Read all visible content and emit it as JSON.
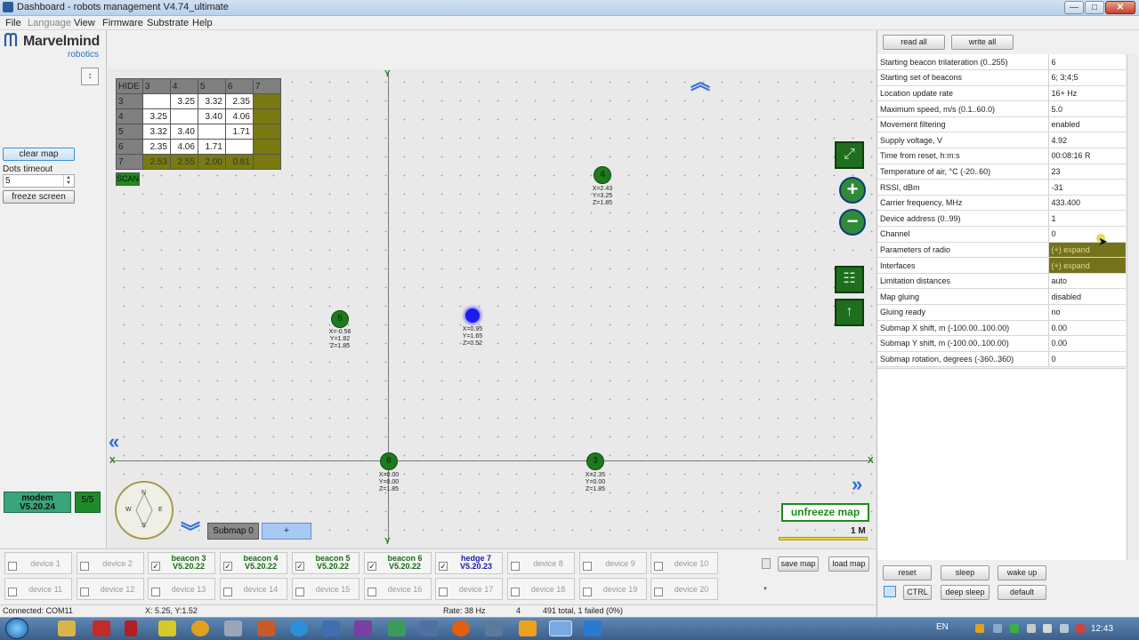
{
  "window": {
    "title": "Dashboard - robots management   V4.74_ultimate",
    "min_glyph": "—",
    "max_glyph": "□",
    "close_glyph": "✕"
  },
  "menu": [
    "File",
    "Language",
    "View",
    "Firmware",
    "Substrate",
    "Help"
  ],
  "left_panel": {
    "logo_text": "Marvelmind",
    "logo_sub": "robotics",
    "clear_map": "clear map",
    "dots_timeout_label": "Dots timeout",
    "dots_timeout_value": "5",
    "freeze_screen": "freeze screen",
    "modem_label": "modem",
    "modem_version": "V5.20.24",
    "modem_count": "5/5",
    "collapse_glyph": "↕"
  },
  "distance_table": {
    "hide_label": "HIDE",
    "scan_label": "SCAN",
    "header": [
      "3",
      "4",
      "5",
      "6",
      "7"
    ],
    "rows": [
      {
        "id": "3",
        "cells": [
          "",
          "3.25",
          "3.32",
          "2.35",
          ""
        ]
      },
      {
        "id": "4",
        "cells": [
          "3.25",
          "",
          "3.40",
          "4.06",
          ""
        ]
      },
      {
        "id": "5",
        "cells": [
          "3.32",
          "3.40",
          "",
          "1.71",
          ""
        ]
      },
      {
        "id": "6",
        "cells": [
          "2.35",
          "4.06",
          "1.71",
          "",
          ""
        ]
      },
      {
        "id": "7",
        "cells": [
          "2.53",
          "2.55",
          "2.00",
          "0.81",
          ""
        ]
      }
    ]
  },
  "map": {
    "beacons": [
      {
        "id": "4",
        "coords": "X=2.43\nY=3.25\nZ=1.85"
      },
      {
        "id": "5",
        "coords": "X=-0.56\nY=1.82\nZ=1.85"
      },
      {
        "id": "6",
        "coords": "X=0.00\nY=0.00\nZ=1.85"
      },
      {
        "id": "3",
        "coords": "X=2.35\nY=0.00\nZ=1.85"
      }
    ],
    "hedge": {
      "id": "7",
      "coords": "X=0.95\nY=1.65\nZ=0.52"
    },
    "axis_x_label": "X",
    "axis_y_label": "Y",
    "compass": {
      "n": "N",
      "s": "S",
      "e": "E",
      "w": "W"
    },
    "submap_label": "Submap 0",
    "submap_add": "+",
    "unfreeze": "unfreeze map",
    "scale": "1 M",
    "zoom_in": "+",
    "zoom_out": "−",
    "up_glyph": "︽",
    "down_glyph": "︾",
    "left_glyph": "«",
    "right_glyph": "»"
  },
  "devices_row1": [
    {
      "label": "device 1",
      "checked": false,
      "active": false
    },
    {
      "label": "device 2",
      "checked": false,
      "active": false
    },
    {
      "label": "beacon 3",
      "version": "V5.20.22",
      "checked": true,
      "active": true,
      "kind": "green"
    },
    {
      "label": "beacon 4",
      "version": "V5.20.22",
      "checked": true,
      "active": true,
      "kind": "green"
    },
    {
      "label": "beacon 5",
      "version": "V5.20.22",
      "checked": true,
      "active": true,
      "kind": "green"
    },
    {
      "label": "beacon 6",
      "version": "V5.20.22",
      "checked": true,
      "active": true,
      "kind": "green"
    },
    {
      "label": "hedge 7",
      "version": "V5.20.23",
      "checked": true,
      "active": true,
      "kind": "blue"
    },
    {
      "label": "device 8",
      "checked": false,
      "active": false
    },
    {
      "label": "device 9",
      "checked": false,
      "active": false
    },
    {
      "label": "device 10",
      "checked": false,
      "active": false
    }
  ],
  "devices_row2": [
    {
      "label": "device 11"
    },
    {
      "label": "device 12"
    },
    {
      "label": "device 13"
    },
    {
      "label": "device 14"
    },
    {
      "label": "device 15"
    },
    {
      "label": "device 16"
    },
    {
      "label": "device 17"
    },
    {
      "label": "device 18"
    },
    {
      "label": "device 19"
    },
    {
      "label": "device 20"
    }
  ],
  "device_buttons": {
    "save_map": "save map",
    "load_map": "load map"
  },
  "status": {
    "connected": "Connected: COM11",
    "cursor_xy": "X: 5.25, Y:1.52",
    "rate": "Rate: 38 Hz",
    "count": "4",
    "totals": "491 total, 1 failed (0%)"
  },
  "right_panel": {
    "read_all": "read all",
    "write_all": "write all",
    "params": [
      {
        "k": "Starting beacon trilateration (0..255)",
        "v": "6"
      },
      {
        "k": "Starting set of beacons",
        "v": "6;  3;4;5"
      },
      {
        "k": "Location update rate",
        "v": "16+ Hz"
      },
      {
        "k": "Maximum speed, m/s (0.1..60.0)",
        "v": "5.0"
      },
      {
        "k": "Movement filtering",
        "v": "enabled"
      },
      {
        "k": "Supply voltage, V",
        "v": "4.92"
      },
      {
        "k": "Time from reset, h:m:s",
        "v": "00:08:16   R"
      },
      {
        "k": "Temperature of air, °C (-20..60)",
        "v": "23"
      },
      {
        "k": "RSSI, dBm",
        "v": "-31"
      },
      {
        "k": "Carrier frequency, MHz",
        "v": "433.400"
      },
      {
        "k": "Device address (0..99)",
        "v": "1"
      },
      {
        "k": "Channel",
        "v": "0"
      },
      {
        "k": "Parameters of radio",
        "v": "(+) expand",
        "olive": true
      },
      {
        "k": "Interfaces",
        "v": "(+) expand",
        "olive": true
      },
      {
        "k": "Limitation distances",
        "v": "auto"
      },
      {
        "k": "Map gluing",
        "v": "disabled"
      },
      {
        "k": "Gluing ready",
        "v": "no"
      },
      {
        "k": "Submap X shift, m (-100.00..100.00)",
        "v": "0.00"
      },
      {
        "k": "Submap Y shift, m (-100.00..100.00)",
        "v": "0.00"
      },
      {
        "k": "Submap rotation, degrees (-360..360)",
        "v": "0"
      }
    ],
    "reset": "reset",
    "sleep": "sleep",
    "wake_up": "wake up",
    "ctrl": "CTRL",
    "deep_sleep": "deep sleep",
    "default": "default"
  },
  "taskbar": {
    "lang": "EN",
    "clock": "12:43"
  },
  "colors": {
    "beacon": "#1f7a1f",
    "hedge": "#1c1cf2",
    "olive": "#75731a",
    "accent": "#3b8fd6"
  }
}
